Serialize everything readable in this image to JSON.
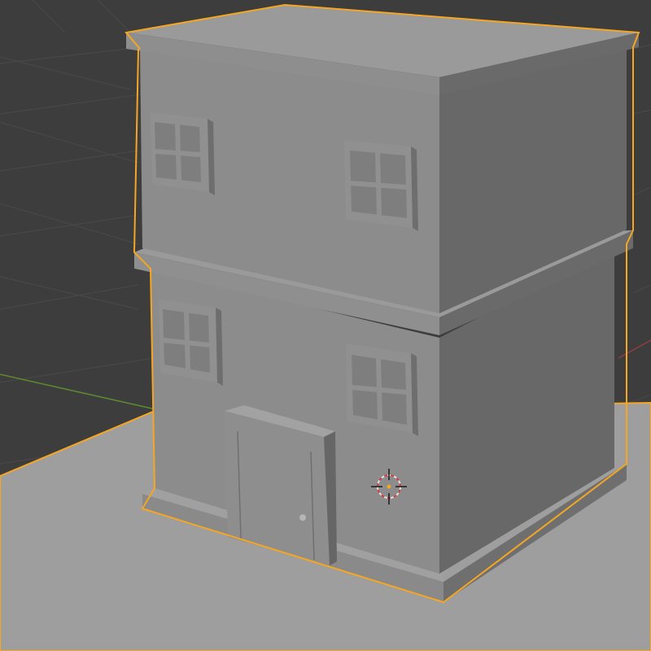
{
  "viewport": {
    "background_color": "#3d3d3d",
    "grid_color": "#4a4a4a",
    "x_axis_color": "#8b3f44",
    "y_axis_color": "#5c8a2e",
    "selection_outline_color": "#f5a623"
  },
  "scene": {
    "objects": [
      {
        "name": "ground plane",
        "selected": true
      },
      {
        "name": "building",
        "selected": true,
        "floors": 2,
        "windows": 4,
        "doors": 1
      }
    ],
    "cursor": {
      "name": "3d-cursor-icon"
    }
  },
  "colors": {
    "wall_front": "#8c8c8c",
    "wall_side": "#686868",
    "roof_top": "#9a9a9a",
    "ground_top": "#9e9e9e",
    "ground_side": "#7a7a7a"
  }
}
